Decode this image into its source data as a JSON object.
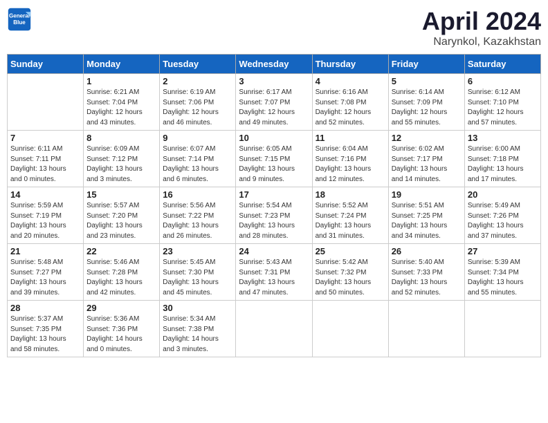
{
  "logo": {
    "line1": "General",
    "line2": "Blue"
  },
  "title": "April 2024",
  "location": "Narynkol, Kazakhstan",
  "headers": [
    "Sunday",
    "Monday",
    "Tuesday",
    "Wednesday",
    "Thursday",
    "Friday",
    "Saturday"
  ],
  "weeks": [
    [
      {
        "day": "",
        "info": ""
      },
      {
        "day": "1",
        "info": "Sunrise: 6:21 AM\nSunset: 7:04 PM\nDaylight: 12 hours\nand 43 minutes."
      },
      {
        "day": "2",
        "info": "Sunrise: 6:19 AM\nSunset: 7:06 PM\nDaylight: 12 hours\nand 46 minutes."
      },
      {
        "day": "3",
        "info": "Sunrise: 6:17 AM\nSunset: 7:07 PM\nDaylight: 12 hours\nand 49 minutes."
      },
      {
        "day": "4",
        "info": "Sunrise: 6:16 AM\nSunset: 7:08 PM\nDaylight: 12 hours\nand 52 minutes."
      },
      {
        "day": "5",
        "info": "Sunrise: 6:14 AM\nSunset: 7:09 PM\nDaylight: 12 hours\nand 55 minutes."
      },
      {
        "day": "6",
        "info": "Sunrise: 6:12 AM\nSunset: 7:10 PM\nDaylight: 12 hours\nand 57 minutes."
      }
    ],
    [
      {
        "day": "7",
        "info": "Sunrise: 6:11 AM\nSunset: 7:11 PM\nDaylight: 13 hours\nand 0 minutes."
      },
      {
        "day": "8",
        "info": "Sunrise: 6:09 AM\nSunset: 7:12 PM\nDaylight: 13 hours\nand 3 minutes."
      },
      {
        "day": "9",
        "info": "Sunrise: 6:07 AM\nSunset: 7:14 PM\nDaylight: 13 hours\nand 6 minutes."
      },
      {
        "day": "10",
        "info": "Sunrise: 6:05 AM\nSunset: 7:15 PM\nDaylight: 13 hours\nand 9 minutes."
      },
      {
        "day": "11",
        "info": "Sunrise: 6:04 AM\nSunset: 7:16 PM\nDaylight: 13 hours\nand 12 minutes."
      },
      {
        "day": "12",
        "info": "Sunrise: 6:02 AM\nSunset: 7:17 PM\nDaylight: 13 hours\nand 14 minutes."
      },
      {
        "day": "13",
        "info": "Sunrise: 6:00 AM\nSunset: 7:18 PM\nDaylight: 13 hours\nand 17 minutes."
      }
    ],
    [
      {
        "day": "14",
        "info": "Sunrise: 5:59 AM\nSunset: 7:19 PM\nDaylight: 13 hours\nand 20 minutes."
      },
      {
        "day": "15",
        "info": "Sunrise: 5:57 AM\nSunset: 7:20 PM\nDaylight: 13 hours\nand 23 minutes."
      },
      {
        "day": "16",
        "info": "Sunrise: 5:56 AM\nSunset: 7:22 PM\nDaylight: 13 hours\nand 26 minutes."
      },
      {
        "day": "17",
        "info": "Sunrise: 5:54 AM\nSunset: 7:23 PM\nDaylight: 13 hours\nand 28 minutes."
      },
      {
        "day": "18",
        "info": "Sunrise: 5:52 AM\nSunset: 7:24 PM\nDaylight: 13 hours\nand 31 minutes."
      },
      {
        "day": "19",
        "info": "Sunrise: 5:51 AM\nSunset: 7:25 PM\nDaylight: 13 hours\nand 34 minutes."
      },
      {
        "day": "20",
        "info": "Sunrise: 5:49 AM\nSunset: 7:26 PM\nDaylight: 13 hours\nand 37 minutes."
      }
    ],
    [
      {
        "day": "21",
        "info": "Sunrise: 5:48 AM\nSunset: 7:27 PM\nDaylight: 13 hours\nand 39 minutes."
      },
      {
        "day": "22",
        "info": "Sunrise: 5:46 AM\nSunset: 7:28 PM\nDaylight: 13 hours\nand 42 minutes."
      },
      {
        "day": "23",
        "info": "Sunrise: 5:45 AM\nSunset: 7:30 PM\nDaylight: 13 hours\nand 45 minutes."
      },
      {
        "day": "24",
        "info": "Sunrise: 5:43 AM\nSunset: 7:31 PM\nDaylight: 13 hours\nand 47 minutes."
      },
      {
        "day": "25",
        "info": "Sunrise: 5:42 AM\nSunset: 7:32 PM\nDaylight: 13 hours\nand 50 minutes."
      },
      {
        "day": "26",
        "info": "Sunrise: 5:40 AM\nSunset: 7:33 PM\nDaylight: 13 hours\nand 52 minutes."
      },
      {
        "day": "27",
        "info": "Sunrise: 5:39 AM\nSunset: 7:34 PM\nDaylight: 13 hours\nand 55 minutes."
      }
    ],
    [
      {
        "day": "28",
        "info": "Sunrise: 5:37 AM\nSunset: 7:35 PM\nDaylight: 13 hours\nand 58 minutes."
      },
      {
        "day": "29",
        "info": "Sunrise: 5:36 AM\nSunset: 7:36 PM\nDaylight: 14 hours\nand 0 minutes."
      },
      {
        "day": "30",
        "info": "Sunrise: 5:34 AM\nSunset: 7:38 PM\nDaylight: 14 hours\nand 3 minutes."
      },
      {
        "day": "",
        "info": ""
      },
      {
        "day": "",
        "info": ""
      },
      {
        "day": "",
        "info": ""
      },
      {
        "day": "",
        "info": ""
      }
    ]
  ]
}
